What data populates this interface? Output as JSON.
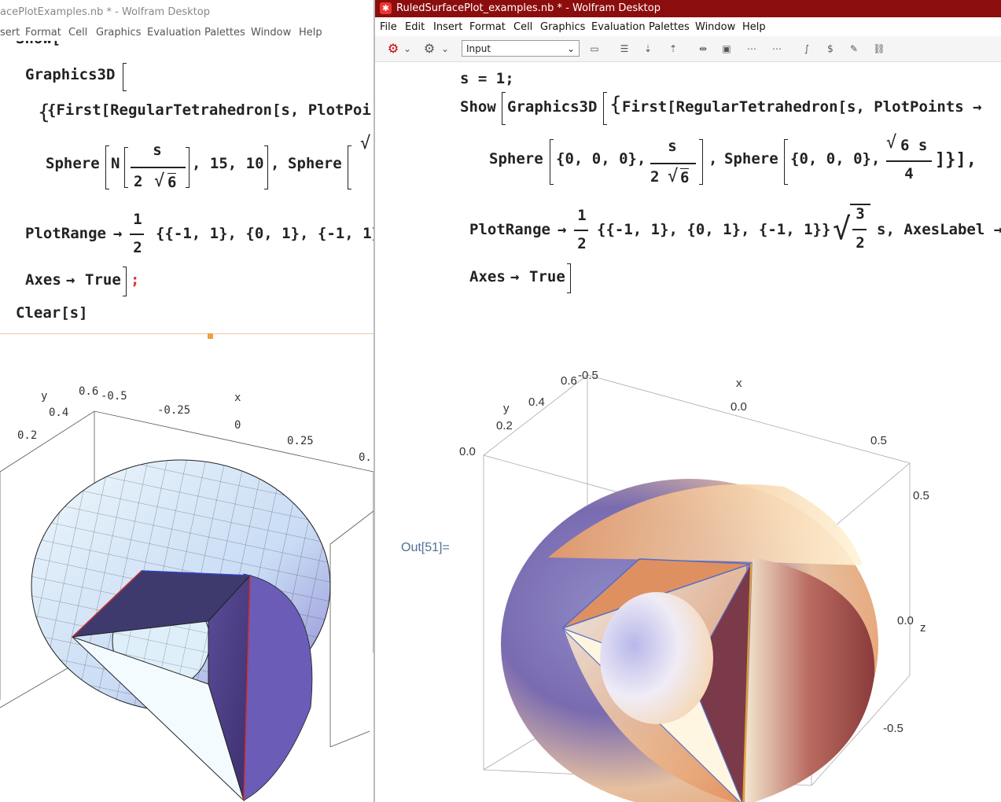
{
  "left_window": {
    "title": "acePlotExamples.nb * - Wolfram Desktop",
    "menu": [
      "sert",
      "Format",
      "Cell",
      "Graphics",
      "Evaluation",
      "Palettes",
      "Window",
      "Help"
    ],
    "code": {
      "show_partial": "Show[",
      "graphics3d": "Graphics3D",
      "first_line": "{First[RegularTetrahedron[s, PlotPoi",
      "sphere1_prefix": "Sphere",
      "n_label": "N",
      "frac_num": "s",
      "frac_den_2": "2",
      "sqrt6": "6",
      "sphere1_args": ", 15, 10",
      "comma": ",",
      "sphere2": "Sphere",
      "plotrange": "PlotRange",
      "arrow": "→",
      "half_num": "1",
      "half_den": "2",
      "ranges": "{{-1, 1}, {0, 1}, {-1, 1}",
      "axes": "Axes",
      "true": "True",
      "semicolon": ";",
      "clear": "Clear[s]"
    },
    "plot_axes": {
      "y_label": "y",
      "x_label": "x",
      "ticks_y": [
        "0.2",
        "0.4",
        "0.6"
      ],
      "ticks_x": [
        "-0.5",
        "-0.25",
        "0",
        "0.25",
        "0."
      ]
    }
  },
  "right_window": {
    "title": "RuledSurfacePlot_examples.nb * - Wolfram Desktop",
    "menu": [
      "File",
      "Edit",
      "Insert",
      "Format",
      "Cell",
      "Graphics",
      "Evaluation",
      "Palettes",
      "Window",
      "Help"
    ],
    "style_select": "Input",
    "code": {
      "line1": "s = 1;",
      "show": "Show",
      "graphics3d": "Graphics3D",
      "first_line": "First[RegularTetrahedron[s, PlotPoints →",
      "sphere": "Sphere",
      "origin": "{0, 0, 0},",
      "frac_num": "s",
      "frac_den_2": "2",
      "sqrt6": "6",
      "sphere2_num": "6 s",
      "sphere2_den": "4",
      "closing": "]}],",
      "plotrange": "PlotRange",
      "arrow": "→",
      "half_num": "1",
      "half_den": "2",
      "ranges": "{{-1, 1}, {0, 1}, {-1, 1}}",
      "sqrt_num": "3",
      "sqrt_den": "2",
      "axeslabel_tail": "s, AxesLabel →",
      "axes": "Axes",
      "true": "True"
    },
    "out_label": "Out[51]=",
    "plot_axes": {
      "x_label": "x",
      "y_label": "y",
      "z_label": "z",
      "ticks_x": [
        "-0.5",
        "0.0",
        "0.5"
      ],
      "ticks_y": [
        "0.0",
        "0.2",
        "0.4",
        "0.6"
      ],
      "ticks_z": [
        "0.5",
        "0.0",
        "-0.5"
      ]
    }
  },
  "colors": {
    "title_bar": "#8c0d0d",
    "out_label": "#4f6f95"
  }
}
